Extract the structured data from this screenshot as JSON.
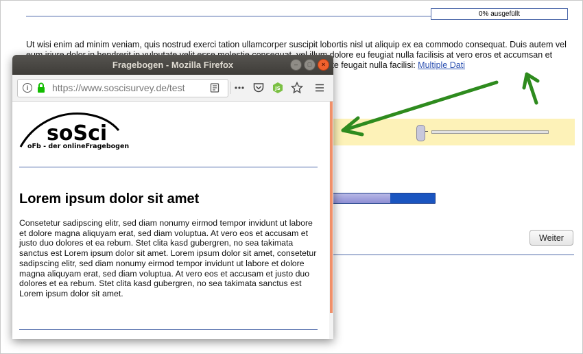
{
  "background_page": {
    "progress_label": "0% ausgefüllt",
    "text_before_link": "Ut wisi enim ad minim veniam, quis nostrud exerci tation ullamcorper suscipit lobortis nisl ut aliquip ex ea commodo consequat. Duis autem vel eum iriure dolor in hendrerit in vulputate velit esse molestie consequat, vel illum dolore eu feugiat nulla facilisis at vero eros et accumsan et iusto odio dignissim qui blandit praesent luptatum zzril delenit augue duis dolore te feugait nulla facilisi: ",
    "link_text": "Multiple Dati",
    "progressbar_fill_fraction": 0.6,
    "next_button_label": "Weiter"
  },
  "popup": {
    "window_title": "Fragebogen - Mozilla Firefox",
    "url": "https://www.soscisurvey.de/test",
    "logo": {
      "wordmark": "soSci",
      "tagline": "oFb - der onlineFragebogen"
    },
    "heading": "Lorem ipsum dolor sit amet",
    "body_text": "Consetetur sadipscing elitr, sed diam nonumy eirmod tempor invidunt ut labore et dolore magna aliquyam erat, sed diam voluptua. At vero eos et accusam et justo duo dolores et ea rebum. Stet clita kasd gubergren, no sea takimata sanctus est Lorem ipsum dolor sit amet. Lorem ipsum dolor sit amet, consetetur sadipscing elitr, sed diam nonumy eirmod tempor invidunt ut labore et dolore magna aliquyam erat, sed diam voluptua. At vero eos et accusam et justo duo dolores et ea rebum. Stet clita kasd gubergren, no sea takimata sanctus est Lorem ipsum dolor sit amet.",
    "icons": [
      "info-icon",
      "lock-icon",
      "reader-mode-icon",
      "more-actions-icon",
      "pocket-icon",
      "extension-icon",
      "bookmark-star-icon",
      "menu-icon"
    ]
  },
  "colors": {
    "accent_line": "#4a66a8",
    "link": "#2a4fb0",
    "annotation_arrow": "#2e8b1e",
    "highlight_row": "#fdf2b8",
    "close_button": "#f0612d"
  }
}
